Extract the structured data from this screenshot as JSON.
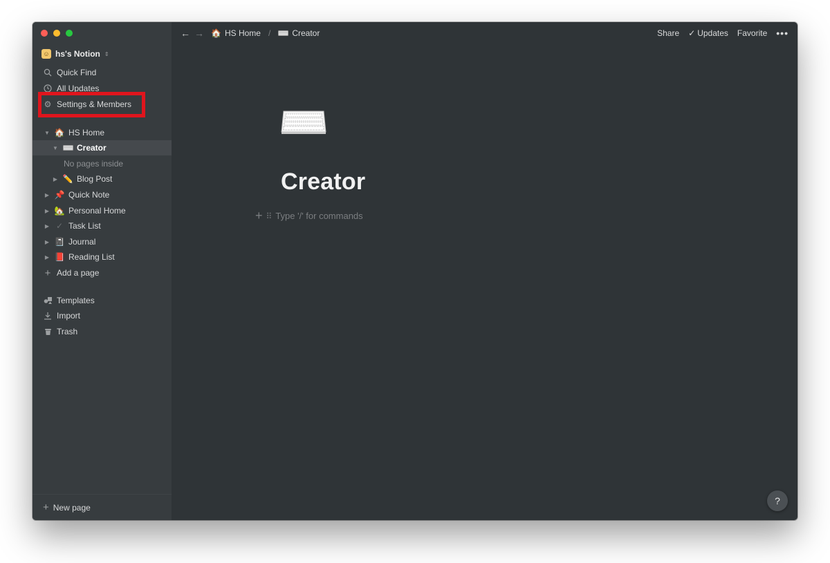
{
  "workspace": {
    "name": "hs's Notion",
    "avatar_icon": "workspace-avatar-icon"
  },
  "sidebar": {
    "quick_find": "Quick Find",
    "all_updates": "All Updates",
    "settings": "Settings & Members",
    "tree": {
      "hs_home": "HS Home",
      "creator": "Creator",
      "no_pages": "No pages inside",
      "blog_post": "Blog Post",
      "quick_note": "Quick Note",
      "personal_home": "Personal Home",
      "task_list": "Task List",
      "journal": "Journal",
      "reading_list": "Reading List"
    },
    "add_page": "Add a page",
    "templates": "Templates",
    "import": "Import",
    "trash": "Trash",
    "new_page": "New page"
  },
  "topbar": {
    "breadcrumb_home": "HS Home",
    "breadcrumb_separator": "/",
    "breadcrumb_current": "Creator",
    "share": "Share",
    "updates": "Updates",
    "favorite": "Favorite",
    "more": "•••"
  },
  "page": {
    "title": "Creator",
    "placeholder": "Type '/' for commands",
    "icon": "keyboard-icon"
  },
  "help": "?",
  "colors": {
    "sidebar_bg": "#373c3f",
    "main_bg": "#2f3437",
    "active_row": "#45494d",
    "highlight_border": "#e0151d"
  }
}
